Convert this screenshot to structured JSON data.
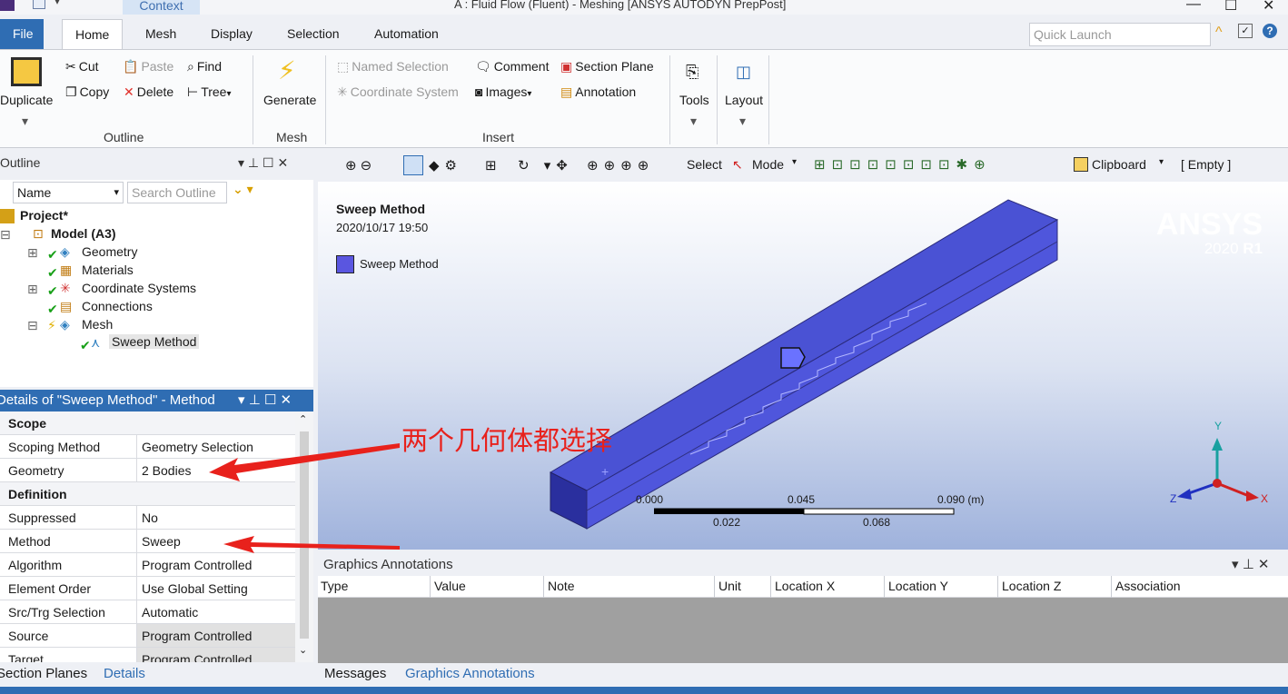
{
  "window": {
    "context_tab": "Context",
    "title": "A : Fluid Flow (Fluent) - Meshing [ANSYS AUTODYN PrepPost]",
    "minimize": "—",
    "maximize": "☐",
    "close": "✕"
  },
  "tabs": [
    "File",
    "Home",
    "Mesh",
    "Display",
    "Selection",
    "Automation"
  ],
  "quick_launch_placeholder": "Quick Launch",
  "ribbon": {
    "duplicate": "Duplicate",
    "cut": "Cut",
    "paste": "Paste",
    "find": "Find",
    "copy": "Copy",
    "delete": "Delete",
    "tree": "Tree",
    "outline_group": "Outline",
    "generate": "Generate",
    "mesh_group": "Mesh",
    "named_selection": "Named Selection",
    "comment": "Comment",
    "section_plane": "Section Plane",
    "coordinate_system": "Coordinate System",
    "images": "Images",
    "annotation": "Annotation",
    "insert_group": "Insert",
    "tools": "Tools",
    "layout": "Layout"
  },
  "outline": {
    "title": "Outline",
    "column": "Name",
    "search_placeholder": "Search Outline",
    "items": [
      {
        "label": "Project*"
      },
      {
        "label": "Model (A3)"
      },
      {
        "label": "Geometry"
      },
      {
        "label": "Materials"
      },
      {
        "label": "Coordinate Systems"
      },
      {
        "label": "Connections"
      },
      {
        "label": "Mesh"
      },
      {
        "label": "Sweep Method"
      }
    ]
  },
  "details": {
    "title": "Details of \"Sweep Method\" - Method",
    "rows": [
      {
        "key": "Scope",
        "value": "",
        "section": true
      },
      {
        "key": "Scoping Method",
        "value": "Geometry Selection"
      },
      {
        "key": "Geometry",
        "value": "2 Bodies"
      },
      {
        "key": "Definition",
        "value": "",
        "section": true
      },
      {
        "key": "Suppressed",
        "value": "No"
      },
      {
        "key": "Method",
        "value": "Sweep"
      },
      {
        "key": "Algorithm",
        "value": "Program Controlled"
      },
      {
        "key": "Element Order",
        "value": "Use Global Setting"
      },
      {
        "key": "Src/Trg Selection",
        "value": "Automatic"
      },
      {
        "key": "Source",
        "value": "Program Controlled"
      },
      {
        "key": "Target",
        "value": "Program Controlled"
      }
    ]
  },
  "left_bottom_tabs": [
    "Section Planes",
    "Details"
  ],
  "graphics_toolbar": {
    "select": "Select",
    "mode": "Mode",
    "clipboard": "Clipboard",
    "clipboard_state": "[ Empty ]"
  },
  "viewport": {
    "object_title": "Sweep Method",
    "date": "2020/10/17 19:50",
    "legend_label": "Sweep Method",
    "brand": "ANSYS",
    "version_prefix": "2020",
    "version_suffix": "R1",
    "scale_top": [
      "0.000",
      "0.045",
      "0.090 (m)"
    ],
    "scale_bottom": [
      "0.022",
      "0.068"
    ],
    "axis_y": "Y",
    "axis_x": "X",
    "axis_z": "Z",
    "body_color": "#4b4fd6"
  },
  "annotation_text": "两个几何体都选择",
  "graphics_annotations": {
    "title": "Graphics Annotations",
    "columns": [
      "Type",
      "Value",
      "Note",
      "Unit",
      "Location X",
      "Location Y",
      "Location Z",
      "Association"
    ]
  },
  "right_bottom_tabs": [
    "Messages",
    "Graphics Annotations"
  ]
}
